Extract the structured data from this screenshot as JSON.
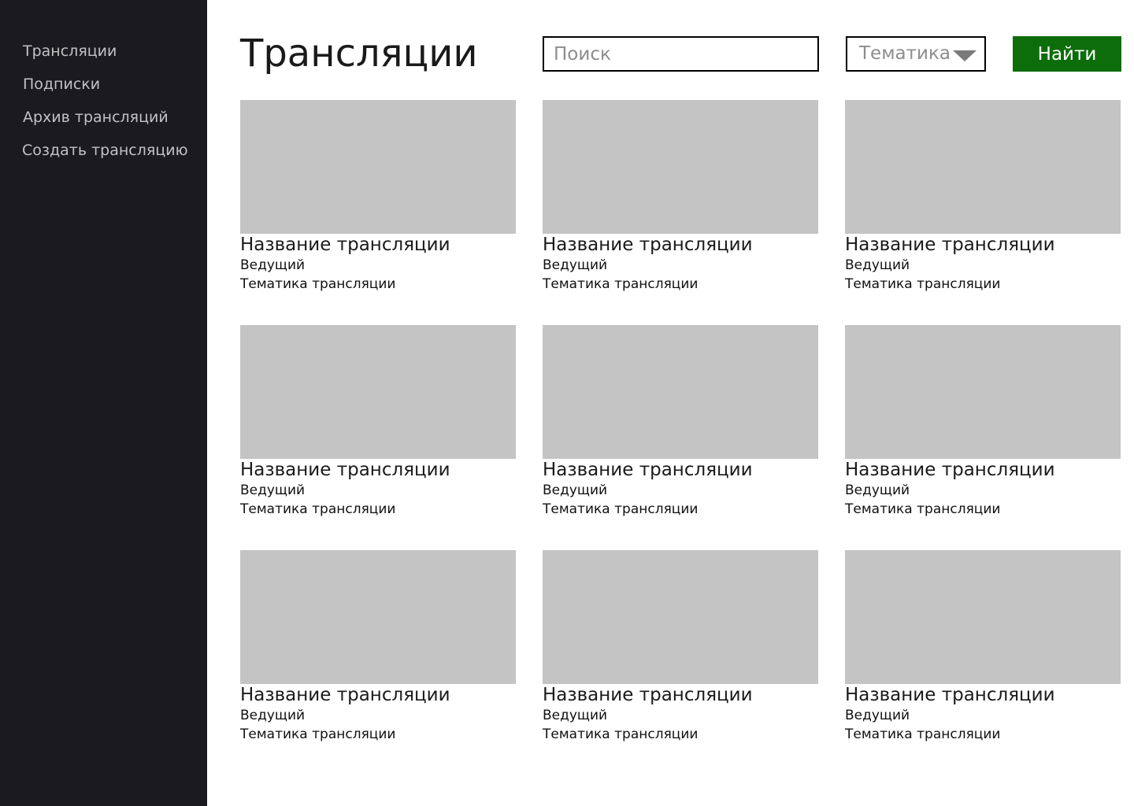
{
  "sidebar": {
    "items": [
      {
        "label": "Трансляции"
      },
      {
        "label": "Подписки"
      },
      {
        "label": "Архив трансляций"
      },
      {
        "label": "Создать трансляцию"
      }
    ]
  },
  "header": {
    "title": "Трансляции",
    "search": {
      "placeholder": "Поиск",
      "value": ""
    },
    "topic_select": {
      "selected": "Тематика"
    },
    "find_label": "Найти"
  },
  "streams": [
    {
      "title": "Название трансляции",
      "host": "Ведущий",
      "topic": "Тематика трансляции"
    },
    {
      "title": "Название трансляции",
      "host": "Ведущий",
      "topic": "Тематика трансляции"
    },
    {
      "title": "Название трансляции",
      "host": "Ведущий",
      "topic": "Тематика трансляции"
    },
    {
      "title": "Название трансляции",
      "host": "Ведущий",
      "topic": "Тематика трансляции"
    },
    {
      "title": "Название трансляции",
      "host": "Ведущий",
      "topic": "Тематика трансляции"
    },
    {
      "title": "Название трансляции",
      "host": "Ведущий",
      "topic": "Тематика трансляции"
    },
    {
      "title": "Название трансляции",
      "host": "Ведущий",
      "topic": "Тематика трансляции"
    },
    {
      "title": "Название трансляции",
      "host": "Ведущий",
      "topic": "Тематика трансляции"
    },
    {
      "title": "Название трансляции",
      "host": "Ведущий",
      "topic": "Тематика трансляции"
    }
  ],
  "colors": {
    "sidebar_bg": "#1b1a1f",
    "sidebar_text": "#c2c2c2",
    "accent": "#0e6d0b",
    "thumbnail": "#c4c4c4"
  },
  "icons": {
    "topic_select_caret": "triangle-down-icon"
  }
}
